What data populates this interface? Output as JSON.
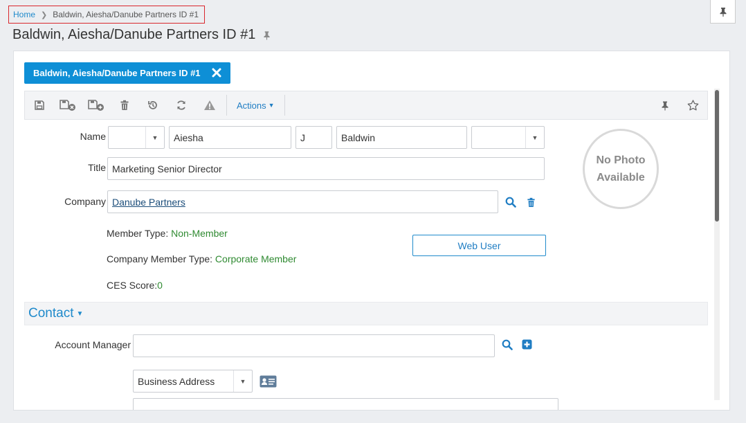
{
  "breadcrumb": {
    "home": "Home",
    "current": "Baldwin, Aiesha/Danube Partners ID #1"
  },
  "page": {
    "title": "Baldwin, Aiesha/Danube Partners ID #1"
  },
  "tab": {
    "label": "Baldwin, Aiesha/Danube Partners ID #1"
  },
  "toolbar": {
    "icons": [
      "save-icon",
      "save-close-icon",
      "save-new-icon",
      "delete-icon",
      "history-icon",
      "refresh-icon",
      "warning-icon"
    ],
    "actions_label": "Actions",
    "right_icons": [
      "pin-icon",
      "star-icon"
    ]
  },
  "form": {
    "name_label": "Name",
    "prefix_value": "",
    "first_name": "Aiesha",
    "middle_name": "J",
    "last_name": "Baldwin",
    "suffix_value": "",
    "title_label": "Title",
    "title_value": "Marketing Senior Director",
    "company_label": "Company",
    "company_value": "Danube Partners",
    "member_type_label": "Member Type: ",
    "member_type_value": "Non-Member",
    "company_member_type_label": "Company Member Type: ",
    "company_member_type_value": "Corporate Member",
    "ces_score_label": "CES Score:",
    "ces_score_value": "0",
    "web_user_label": "Web User"
  },
  "photo": {
    "line1": "No Photo",
    "line2": "Available"
  },
  "contact": {
    "section_title": "Contact",
    "account_manager_label": "Account Manager",
    "account_manager_value": "",
    "address_type": "Business Address"
  },
  "colors": {
    "accent": "#0e8fd6",
    "link": "#1f8acb",
    "green": "#2f8a31",
    "highlight": "#d9262c"
  }
}
